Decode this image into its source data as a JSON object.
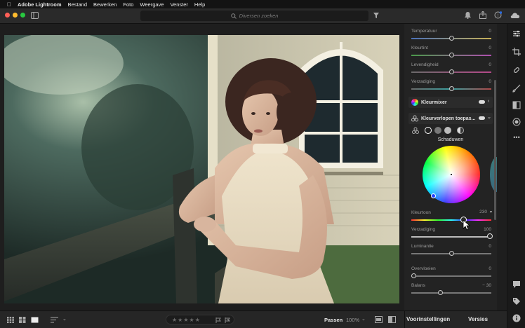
{
  "menubar": {
    "app_name": "Adobe Lightroom",
    "items": [
      "Bestand",
      "Bewerken",
      "Foto",
      "Weergave",
      "Venster",
      "Help"
    ]
  },
  "titlebar": {
    "search_placeholder": "Diversen zoeken"
  },
  "panel": {
    "light_sliders": [
      {
        "label": "Temperatuur",
        "value": "0",
        "position": 0.5
      },
      {
        "label": "Kleurtint",
        "value": "0",
        "position": 0.5
      },
      {
        "label": "Levendigheid",
        "value": "0",
        "position": 0.5
      },
      {
        "label": "Verzadiging",
        "value": "0",
        "position": 0.5
      }
    ],
    "kleurmixer_title": "Kleurmixer",
    "grading_title": "Kleurverlopen toepas...",
    "mode_label": "Schaduwen",
    "hue": {
      "label": "Kleurtoon",
      "value": "230",
      "position": 0.64
    },
    "saturation": {
      "label": "Verzadiging",
      "value": "100",
      "position": 1.0
    },
    "luminance": {
      "label": "Luminantie",
      "value": "0",
      "position": 0.5
    },
    "blending": {
      "label": "Overvloeien",
      "value": "0",
      "position": 0.0
    },
    "balance": {
      "label": "Balans",
      "value": "− 30",
      "position": 0.35
    }
  },
  "bottombar": {
    "fit_label": "Passen",
    "zoom_label": "100%",
    "stars": "★★★★★"
  },
  "tabs": {
    "presets": "Voorinstellingen",
    "versions": "Versies"
  },
  "colors": {
    "accent_blue": "#2d6cdf",
    "panel_bg": "#232323"
  }
}
